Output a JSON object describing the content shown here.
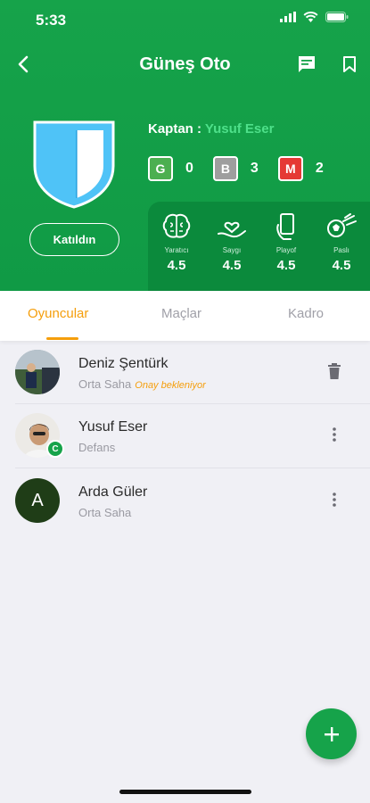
{
  "status_bar": {
    "time": "5:33"
  },
  "nav": {
    "title": "Güneş Oto"
  },
  "team": {
    "captain_label": "Kaptan :",
    "captain_name": "Yusuf Eser",
    "join_label": "Katıldın",
    "cards": [
      {
        "letter": "G",
        "count": "0",
        "color": "#4caf50"
      },
      {
        "letter": "B",
        "count": "3",
        "color": "#9e9e9e"
      },
      {
        "letter": "M",
        "count": "2",
        "color": "#e53935"
      }
    ]
  },
  "stats": [
    {
      "label": "Yaratıcı",
      "value": "4.5",
      "icon": "brain-icon"
    },
    {
      "label": "Saygı",
      "value": "4.5",
      "icon": "heart-hand-icon"
    },
    {
      "label": "Playof",
      "value": "4.5",
      "icon": "phone-hand-icon"
    },
    {
      "label": "Paslı",
      "value": "4.5",
      "icon": "ball-icon"
    }
  ],
  "tabs": [
    {
      "label": "Oyuncular",
      "active": true
    },
    {
      "label": "Maçlar",
      "active": false
    },
    {
      "label": "Kadro",
      "active": false
    }
  ],
  "players": [
    {
      "name": "Deniz Şentürk",
      "position": "Orta Saha",
      "status": "Onay bekleniyor",
      "action": "trash-icon"
    },
    {
      "name": "Yusuf Eser",
      "position": "Defans",
      "captain_badge": "C",
      "action": "more-vertical-icon"
    },
    {
      "name": "Arda Güler",
      "position": "Orta Saha",
      "initial": "A",
      "action": "more-vertical-icon"
    }
  ],
  "colors": {
    "primary": "#16a34a",
    "accent": "#f59e0b",
    "captain_name": "#4ee08a"
  }
}
